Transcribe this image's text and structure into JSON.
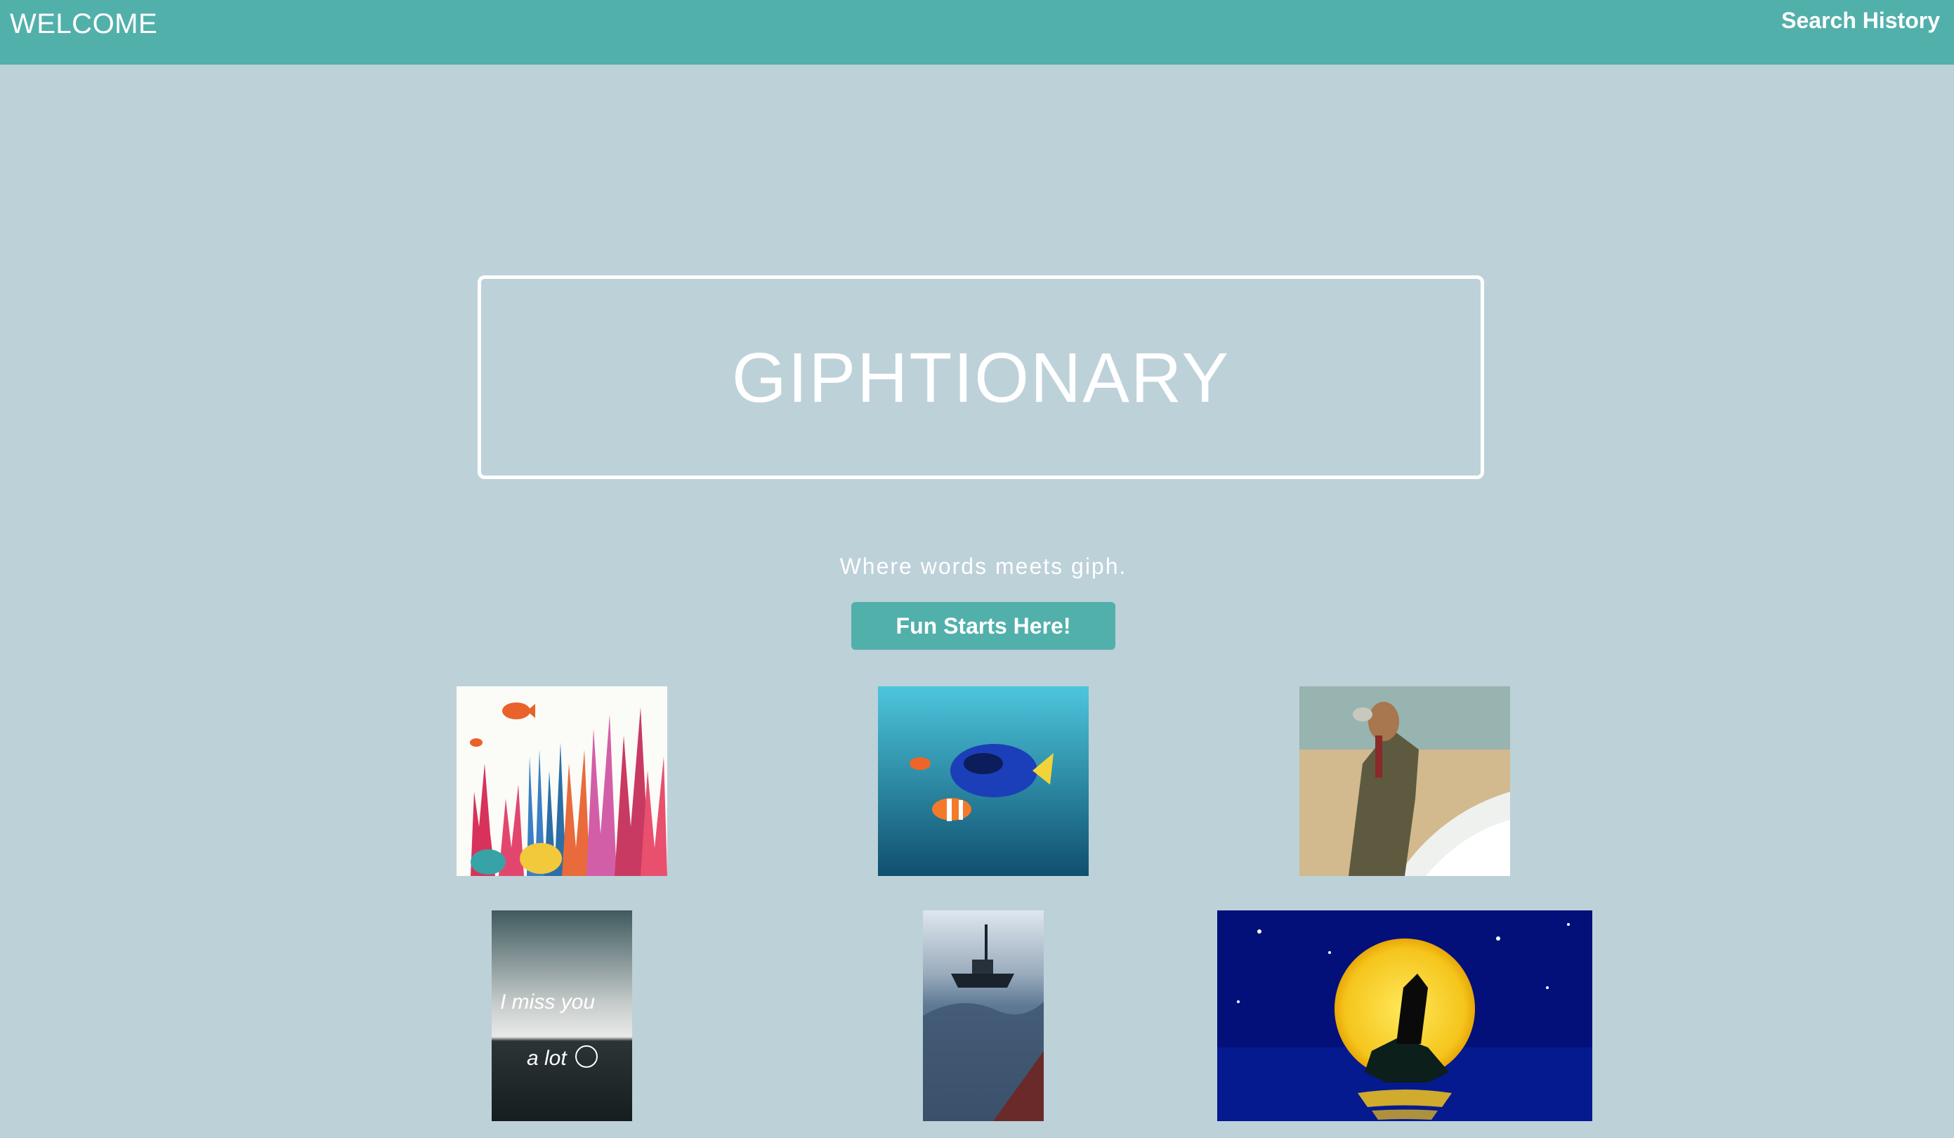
{
  "navbar": {
    "brand": "WELCOME",
    "search_history": "Search History",
    "color": "#52b0ab"
  },
  "hero": {
    "title": "GIPHTIONARY",
    "tagline": "Where words meets giph.",
    "cta_label": "Fun Starts Here!"
  },
  "gifs": [
    {
      "subject": "coral reef with fish illustration"
    },
    {
      "subject": "animated fish swimming underwater"
    },
    {
      "subject": "man in suit on beach"
    },
    {
      "subject": "ocean waves",
      "caption_line1": "I miss you",
      "caption_line2": "a lot"
    },
    {
      "subject": "ship on stormy sea"
    },
    {
      "subject": "mermaid on rock under full moon"
    }
  ],
  "colors": {
    "background": "#bdd1d8",
    "accent": "#52b0ab",
    "text": "#ffffff"
  }
}
